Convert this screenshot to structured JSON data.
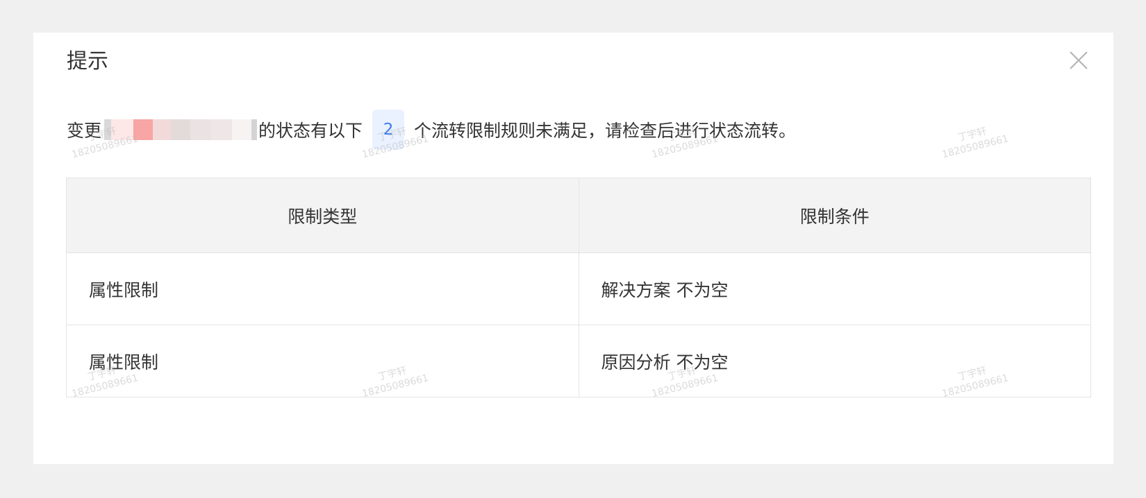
{
  "dialog": {
    "title": "提示",
    "close_icon": "close-icon"
  },
  "message": {
    "prefix": "变更",
    "middle": "的状态有以下",
    "count": "2",
    "suffix": "个流转限制规则未满足，请检查后进行状态流转。"
  },
  "table": {
    "columns": [
      "限制类型",
      "限制条件"
    ],
    "rows": [
      {
        "type": "属性限制",
        "condition": "解决方案 不为空"
      },
      {
        "type": "属性限制",
        "condition": "原因分析 不为空"
      }
    ]
  },
  "watermark": {
    "name": "丁宇轩",
    "phone": "18205089661"
  },
  "colors": {
    "badge_bg": "#eaf1ff",
    "badge_text": "#3a7bf0",
    "header_bg": "#f3f3f3",
    "border": "#e4e4e4"
  }
}
